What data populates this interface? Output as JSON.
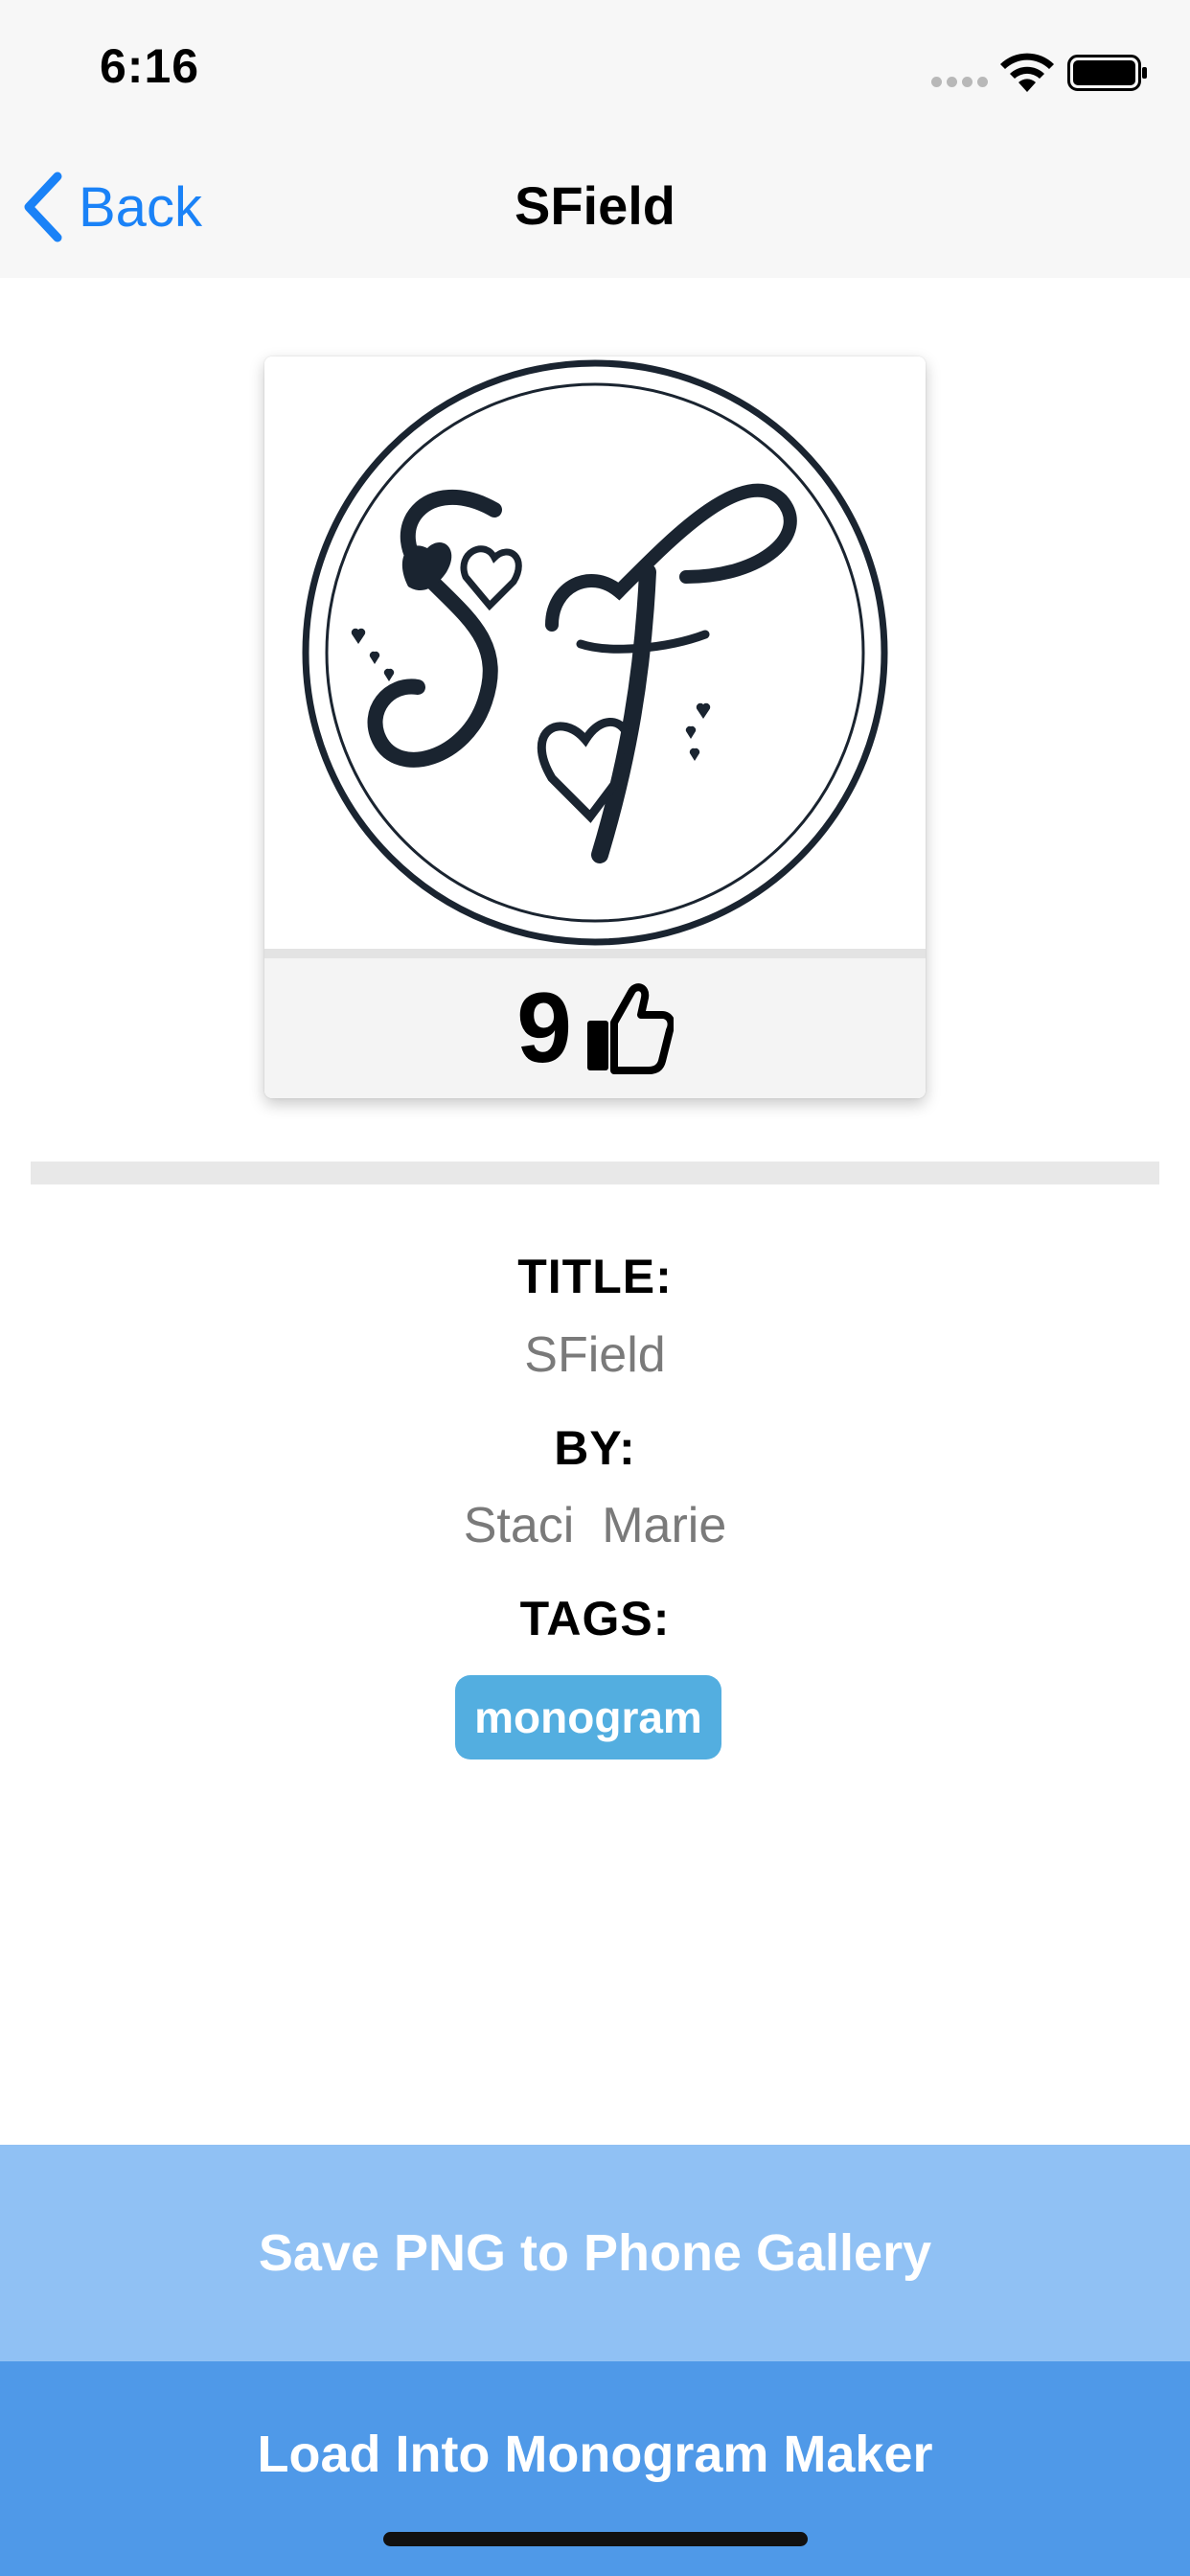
{
  "status_bar": {
    "time": "6:16",
    "icons": [
      "signal-dots-icon",
      "wifi-icon",
      "battery-icon"
    ]
  },
  "nav": {
    "back_label": "Back",
    "title": "SField",
    "accent_color": "#1a82f7"
  },
  "card": {
    "image_description": "SF heart monogram",
    "monogram_letters": "SF",
    "likes": "9",
    "like_icon": "thumbs-up-icon"
  },
  "details": {
    "title_label": "TITLE:",
    "title_value": "SField",
    "by_label": "BY:",
    "by_value": "Staci  Marie",
    "tags_label": "TAGS:",
    "tags": [
      "monogram"
    ],
    "tag_color": "#53aee0"
  },
  "actions": {
    "save_label": "Save PNG to Phone Gallery",
    "save_color": "#90c1f4",
    "load_label": "Load Into Monogram Maker",
    "load_color": "#4f99e8"
  }
}
